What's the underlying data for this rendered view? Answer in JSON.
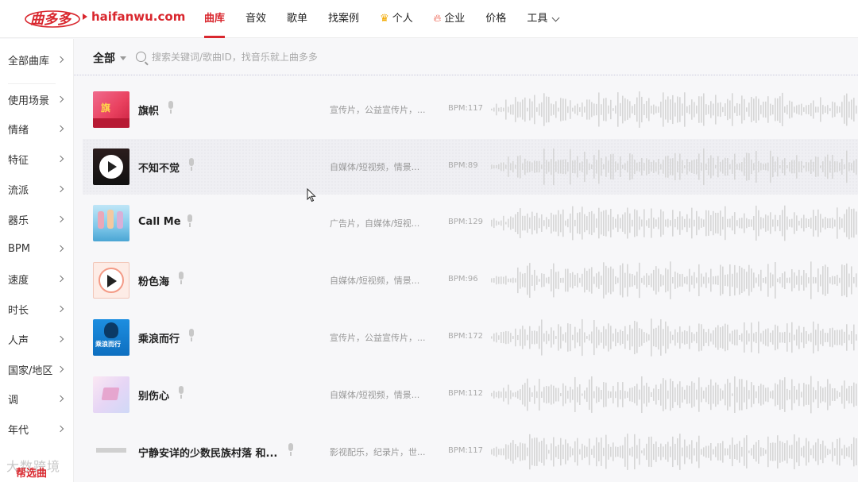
{
  "header": {
    "logo_text": "曲多多",
    "domain": "haifanwu.com",
    "nav": [
      {
        "label": "曲库",
        "icon": "",
        "active": true
      },
      {
        "label": "音效",
        "icon": "",
        "active": false
      },
      {
        "label": "歌单",
        "icon": "",
        "active": false
      },
      {
        "label": "找案例",
        "icon": "",
        "active": false
      },
      {
        "label": "个人",
        "icon": "crown-icon",
        "active": false
      },
      {
        "label": "企业",
        "icon": "flame-icon",
        "active": false
      },
      {
        "label": "价格",
        "icon": "",
        "active": false
      },
      {
        "label": "工具",
        "icon": "chevron-down-icon",
        "active": false
      }
    ]
  },
  "sidebar": {
    "top": "全部曲库",
    "items": [
      "使用场景",
      "情绪",
      "特征",
      "流派",
      "器乐",
      "BPM",
      "速度",
      "时长",
      "人声",
      "国家/地区",
      "调",
      "年代"
    ]
  },
  "search": {
    "category": "全部",
    "placeholder": "搜索关键词/歌曲ID，找音乐就上曲多多"
  },
  "tracks": [
    {
      "title": "旗帜",
      "tags": "宣传片，公益宣传片，...",
      "bpm": "BPM:117"
    },
    {
      "title": "不知不觉",
      "tags": "自媒体/短视频，情景...",
      "bpm": "BPM:89"
    },
    {
      "title": "Call Me",
      "tags": "广告片，自媒体/短视...",
      "bpm": "BPM:129"
    },
    {
      "title": "粉色海",
      "tags": "自媒体/短视频，情景...",
      "bpm": "BPM:96"
    },
    {
      "title": "乘浪而行",
      "tags": "宣传片，公益宣传片，...",
      "bpm": "BPM:172"
    },
    {
      "title": "别伤心",
      "tags": "自媒体/短视频，情景...",
      "bpm": "BPM:112"
    },
    {
      "title": "宁静安详的少数民族村落 和...",
      "tags": "影视配乐，纪录片，世...",
      "bpm": "BPM:117"
    }
  ],
  "watermark": {
    "text": "大数跨境",
    "mark": "帮选曲"
  },
  "colors": {
    "accent": "#d9272e",
    "waveform": "#d6d6d6"
  }
}
